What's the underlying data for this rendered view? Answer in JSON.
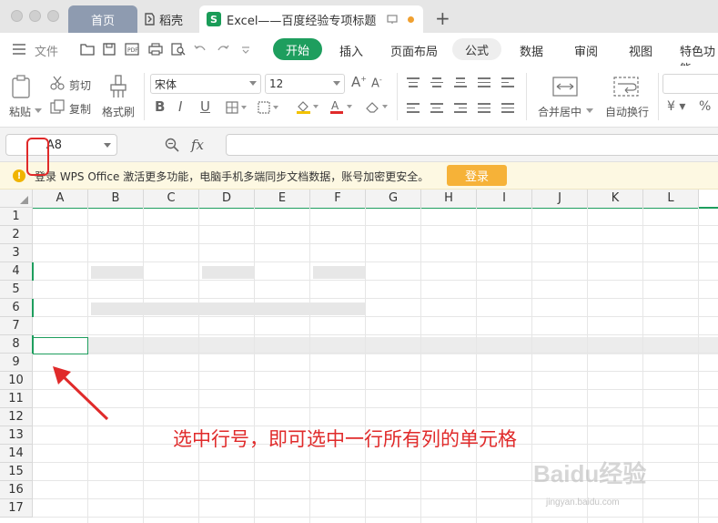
{
  "titlebar": {
    "tabs": [
      {
        "label": "首页"
      },
      {
        "label": "稻壳"
      },
      {
        "label": "Excel——百度经验专项标题"
      }
    ],
    "new_tab": "+"
  },
  "menubar": {
    "file": "文件",
    "items": [
      "开始",
      "插入",
      "页面布局",
      "公式",
      "数据",
      "审阅",
      "视图",
      "特色功能"
    ]
  },
  "ribbon": {
    "paste": "粘贴",
    "cut": "剪切",
    "copy": "复制",
    "format_painter": "格式刷",
    "font_name": "宋体",
    "font_size": "12",
    "merge_center": "合并居中",
    "wrap_text": "自动换行"
  },
  "formula_bar": {
    "name_box": "A8",
    "fx": "fx",
    "value": ""
  },
  "notice": {
    "text": "登录 WPS Office 激活更多功能，电脑手机多端同步文档数据，账号加密更安全。",
    "login_button": "登录"
  },
  "grid": {
    "columns": [
      "A",
      "B",
      "C",
      "D",
      "E",
      "F",
      "G",
      "H",
      "I",
      "J",
      "K",
      "L"
    ],
    "rows": [
      "1",
      "2",
      "3",
      "4",
      "5",
      "6",
      "7",
      "8",
      "9",
      "10",
      "11",
      "12",
      "13",
      "14",
      "15",
      "16",
      "17"
    ],
    "active_cell": "A8",
    "selected_row": "8"
  },
  "annotation": {
    "text": "选中行号，即可选中一行所有列的单元格",
    "color": "#e02a2a"
  },
  "watermark": {
    "text": "Baidu经验",
    "sub": "jingyan.baidu.com"
  },
  "colors": {
    "accent": "#1e9e5e",
    "login": "#f6b238"
  }
}
